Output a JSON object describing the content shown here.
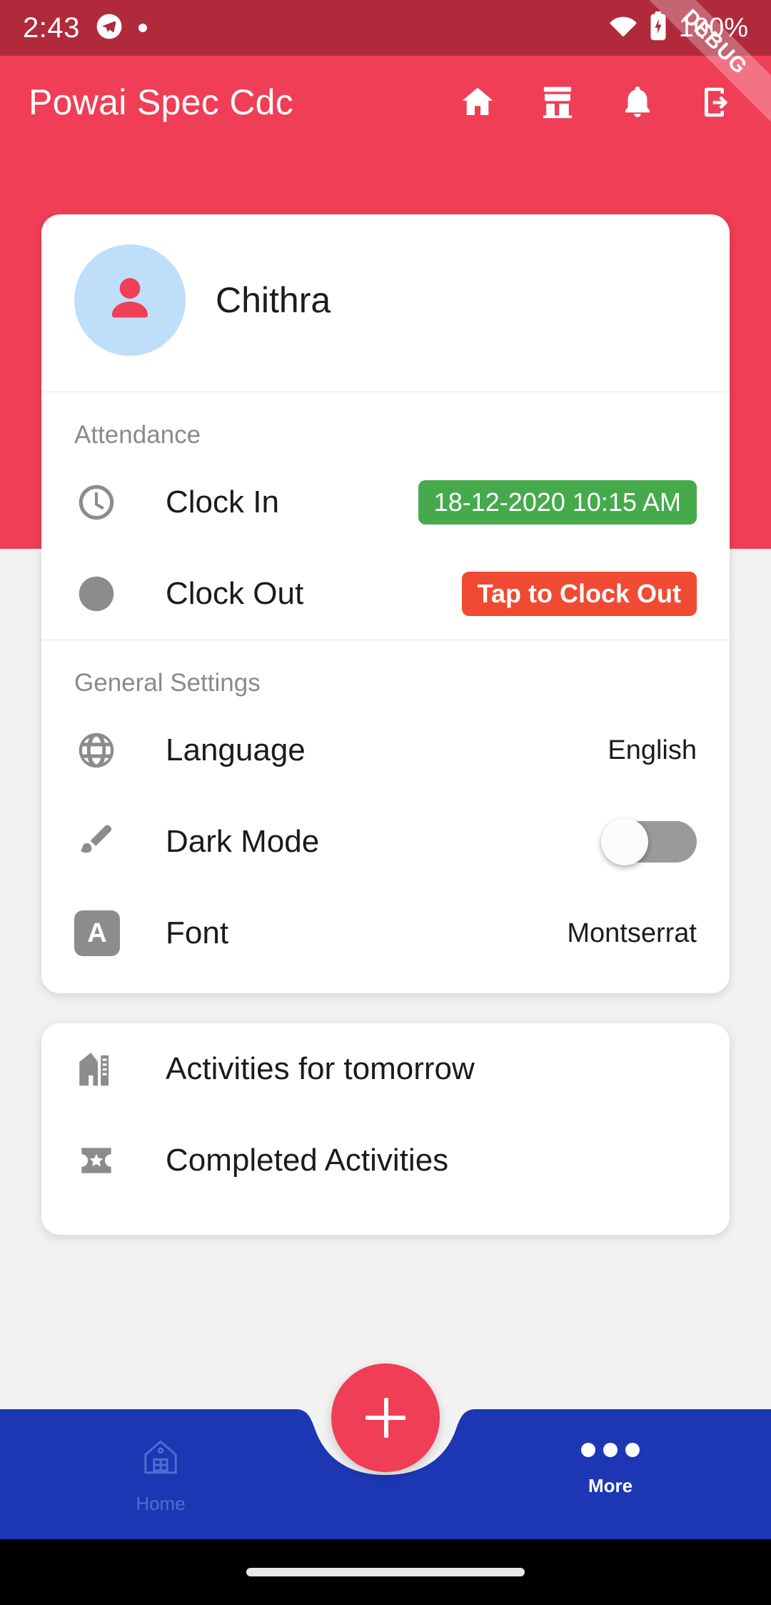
{
  "status_bar": {
    "time": "2:43",
    "battery_text": "100%",
    "icons": [
      "telegram-icon",
      "notification-dot",
      "wifi-icon",
      "battery-charging-icon"
    ]
  },
  "debug_ribbon": {
    "label": "DEBUG"
  },
  "app_bar": {
    "title": "Powai Spec Cdc",
    "actions": [
      {
        "name": "home-icon",
        "label": "Home"
      },
      {
        "name": "store-icon",
        "label": "Store"
      },
      {
        "name": "bell-icon",
        "label": "Notifications"
      },
      {
        "name": "logout-icon",
        "label": "Logout"
      }
    ]
  },
  "profile": {
    "name": "Chithra",
    "avatar_icon": "person-icon",
    "avatar_bg": "#bfdefa",
    "avatar_fg": "#ef3e56"
  },
  "attendance": {
    "section_title": "Attendance",
    "rows": [
      {
        "icon": "clock-outline-icon",
        "label": "Clock In",
        "badge": "18-12-2020 10:15 AM",
        "badge_color": "#46aa4d",
        "badge_style": "green"
      },
      {
        "icon": "clock-filled-icon",
        "label": "Clock Out",
        "badge": "Tap to Clock Out",
        "badge_color": "#f04a33",
        "badge_style": "red"
      }
    ]
  },
  "general_settings": {
    "section_title": "General Settings",
    "language": {
      "icon": "globe-icon",
      "label": "Language",
      "value": "English"
    },
    "dark_mode": {
      "icon": "paintbrush-icon",
      "label": "Dark Mode",
      "value": "off"
    },
    "font": {
      "icon": "font-a-icon",
      "label": "Font",
      "value": "Montserrat"
    }
  },
  "activities": {
    "items": [
      {
        "icon": "buildings-icon",
        "label": "Activities for tomorrow"
      },
      {
        "icon": "ticket-star-icon",
        "label": "Completed Activities"
      }
    ]
  },
  "bottom_nav": {
    "background": "#1c36b4",
    "items": [
      {
        "name": "home",
        "icon": "house-outline-icon",
        "label": "Home",
        "active": false
      },
      {
        "name": "more",
        "icon": "dots-icon",
        "label": "More",
        "active": true
      }
    ],
    "fab": {
      "icon": "plus-icon",
      "color": "#ef3e56"
    }
  },
  "theme": {
    "primary": "#ef3e56",
    "status_bar_bg": "#b02a3c",
    "nav_bg": "#1c36b4",
    "page_bg": "#f2f2f2"
  }
}
